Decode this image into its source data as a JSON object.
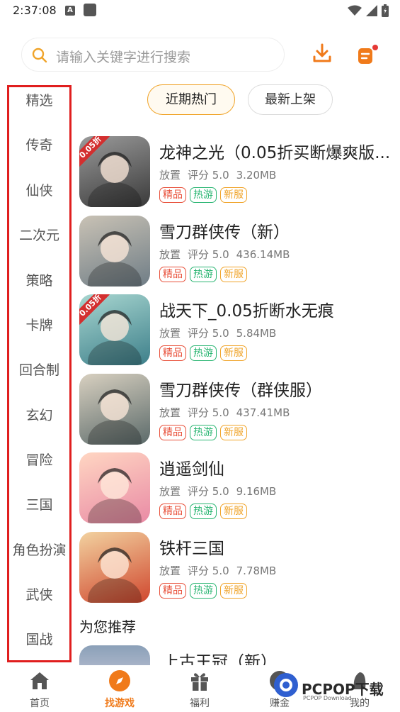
{
  "status_bar": {
    "time": "2:37:08",
    "a_badge": "A"
  },
  "search": {
    "placeholder": "请输入关键字进行搜索"
  },
  "categories": [
    "精选",
    "传奇",
    "仙侠",
    "二次元",
    "策略",
    "卡牌",
    "回合制",
    "玄幻",
    "冒险",
    "三国",
    "角色扮演",
    "武侠",
    "国战"
  ],
  "tabs": {
    "active": "近期热门",
    "inactive": "最新上架"
  },
  "games": [
    {
      "title": "龙神之光（0.05折买断爆爽版...",
      "genre": "放置",
      "score": "评分 5.0",
      "size": "3.20MB",
      "badge": "0.05折",
      "icon_colors": [
        "#3a3a3a",
        "#9a9a9a"
      ]
    },
    {
      "title": "雪刀群侠传（新）",
      "genre": "放置",
      "score": "评分 5.0",
      "size": "436.14MB",
      "badge": "",
      "icon_colors": [
        "#6f7d86",
        "#c9c2b5"
      ]
    },
    {
      "title": "战天下_0.05折断水无痕",
      "genre": "放置",
      "score": "评分 5.0",
      "size": "5.84MB",
      "badge": "0.05折",
      "icon_colors": [
        "#3d7f8a",
        "#a8d6d0"
      ]
    },
    {
      "title": "雪刀群侠传（群侠服）",
      "genre": "放置",
      "score": "评分 5.0",
      "size": "437.41MB",
      "badge": "",
      "icon_colors": [
        "#5b6a6a",
        "#d8d0c0"
      ]
    },
    {
      "title": "逍遥剑仙",
      "genre": "放置",
      "score": "评分 5.0",
      "size": "9.16MB",
      "badge": "",
      "icon_colors": [
        "#e98aa5",
        "#ffd6c2"
      ]
    },
    {
      "title": "铁杆三国",
      "genre": "放置",
      "score": "评分 5.0",
      "size": "7.78MB",
      "badge": "",
      "icon_colors": [
        "#d0472e",
        "#f2d2a0"
      ]
    }
  ],
  "tags": {
    "premium": "精品",
    "hot": "热游",
    "new_server": "新服"
  },
  "section": {
    "recommend": "为您推荐"
  },
  "recommend_first": {
    "title": "上古王冠（新）"
  },
  "nav": [
    {
      "label": "首页",
      "icon": "home-icon"
    },
    {
      "label": "找游戏",
      "icon": "compass-icon"
    },
    {
      "label": "福利",
      "icon": "gift-icon"
    },
    {
      "label": "赚金",
      "icon": "coin-icon"
    },
    {
      "label": "我的",
      "icon": "profile-icon"
    }
  ],
  "watermark": {
    "text": "PCPOP下载",
    "sub": "PCPOP Download"
  },
  "colors": {
    "accent": "#f07a1a",
    "highlight_border": "#e01e1e",
    "tag_red": "#e8503a",
    "tag_green": "#2bb673",
    "tag_orange": "#f0a42a"
  }
}
